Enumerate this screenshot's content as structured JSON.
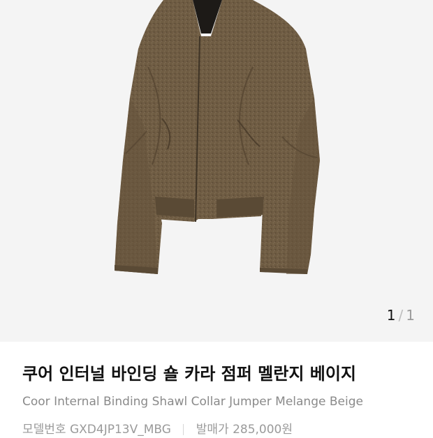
{
  "pager": {
    "current": "1",
    "separator": "/",
    "total": "1"
  },
  "product": {
    "name_ko": "쿠어 인터널 바인딩 숄 카라 점퍼 멜란지 베이지",
    "name_en": "Coor Internal Binding Shawl Collar Jumper Melange Beige",
    "model_label": "모델번호",
    "model_number": "GXD4JP13V_MBG",
    "release_price_label": "발매가",
    "release_price": "285,000원"
  },
  "image": {
    "icon": "jacket-product-image",
    "jacket_color": "#6f5c43",
    "background_color": "#f4f4f4"
  }
}
